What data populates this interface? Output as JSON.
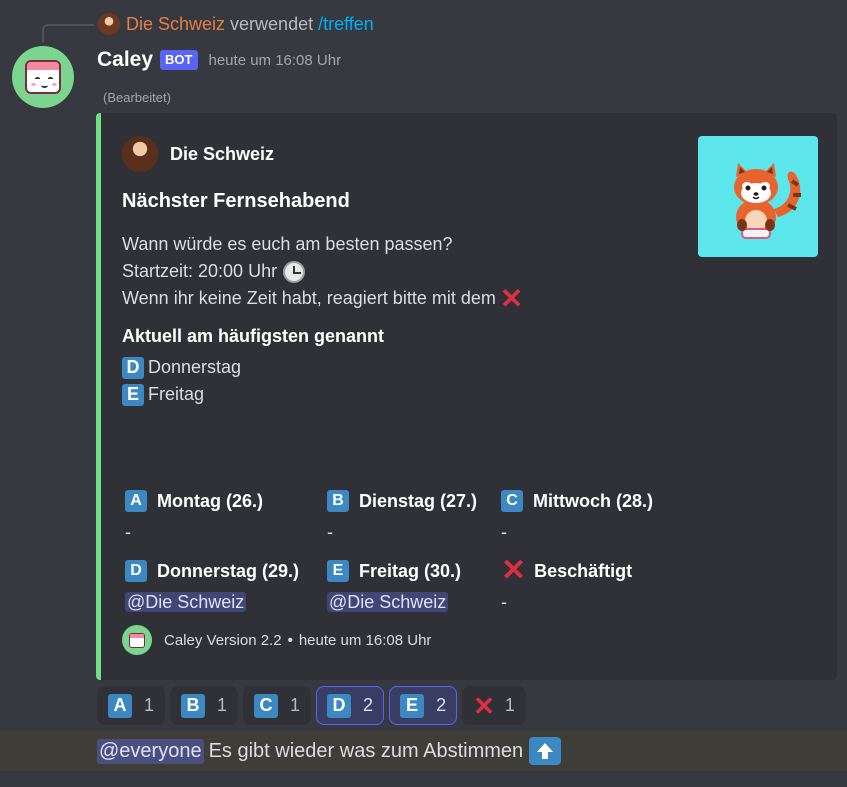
{
  "reply": {
    "user": "Die Schweiz",
    "action": "verwendet",
    "command": "/treffen"
  },
  "message": {
    "username": "Caley",
    "bot_tag": "BOT",
    "timestamp": "heute um 16:08 Uhr",
    "edited": "(Bearbeitet)"
  },
  "embed": {
    "accent_color": "#70e084",
    "author": "Die Schweiz",
    "thumbnail_icon": "red-panda-icon",
    "title": "Nächster Fernsehabend",
    "description": [
      "Wann würde es euch am besten passen?",
      "Startzeit: 20:00 Uhr",
      "Wenn ihr keine Zeit habt, reagiert bitte mit dem"
    ],
    "current_title": "Aktuell am häufigsten genannt",
    "current": [
      {
        "letter": "D",
        "label": "Donnerstag"
      },
      {
        "letter": "E",
        "label": "Freitag"
      }
    ],
    "fields": [
      {
        "letter": "A",
        "name": "Montag (26.)",
        "value": "-"
      },
      {
        "letter": "B",
        "name": "Dienstag (27.)",
        "value": "-"
      },
      {
        "letter": "C",
        "name": "Mittwoch (28.)",
        "value": "-"
      },
      {
        "letter": "D",
        "name": "Donnerstag (29.)",
        "value": "@Die Schweiz"
      },
      {
        "letter": "E",
        "name": "Freitag (30.)",
        "value": "@Die Schweiz"
      },
      {
        "letter": "✕",
        "name": "Beschäftigt",
        "value": "-"
      }
    ],
    "footer": {
      "text": "Caley Version 2.2",
      "separator": "•",
      "timestamp": "heute um 16:08 Uhr"
    }
  },
  "reactions": [
    {
      "emoji": "A",
      "count": "1",
      "me": false
    },
    {
      "emoji": "B",
      "count": "1",
      "me": false
    },
    {
      "emoji": "C",
      "count": "1",
      "me": false
    },
    {
      "emoji": "D",
      "count": "2",
      "me": true
    },
    {
      "emoji": "E",
      "count": "2",
      "me": true
    },
    {
      "emoji": "✕",
      "count": "1",
      "me": false
    }
  ],
  "second_message": {
    "mention": "@everyone",
    "text": "Es gibt wieder was zum Abstimmen"
  },
  "colors": {
    "background": "#36393f",
    "embed_bg": "#2f3136",
    "blurple": "#5865f2",
    "letter_blue": "#3b88c3",
    "x_red": "#dd2e44"
  }
}
